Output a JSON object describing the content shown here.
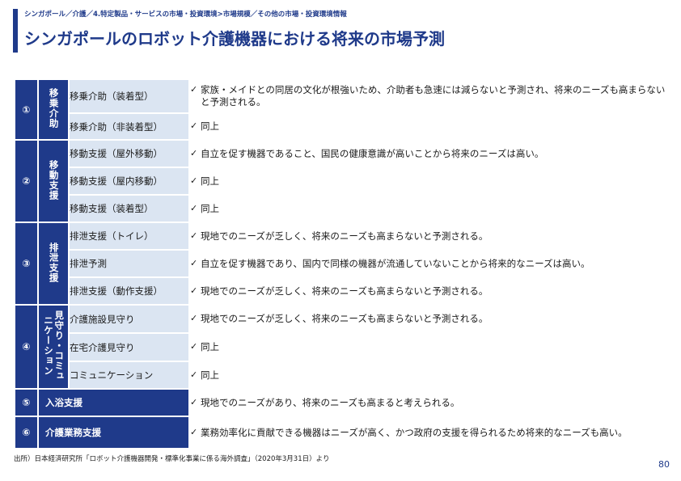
{
  "header": {
    "breadcrumb": "シンガポール／介護／4.特定製品・サービスの市場・投資環境>市場規模／その他の市場・投資環境情報",
    "title": "シンガポールのロボット介護機器における将来の市場予測"
  },
  "table": {
    "groups": [
      {
        "number": "①",
        "category": "移乗介助",
        "rows": [
          {
            "item": "移乗介助（装着型）",
            "desc": "家族・メイドとの同居の文化が根強いため、介助者も急速には減らないと予測され、将来のニーズも高まらないと予測される。"
          },
          {
            "item": "移乗介助（非装着型）",
            "desc": "同上"
          }
        ]
      },
      {
        "number": "②",
        "category": "移動支援",
        "rows": [
          {
            "item": "移動支援（屋外移動）",
            "desc": "自立を促す機器であること、国民の健康意識が高いことから将来のニーズは高い。"
          },
          {
            "item": "移動支援（屋内移動）",
            "desc": "同上"
          },
          {
            "item": "移動支援（装着型）",
            "desc": "同上"
          }
        ]
      },
      {
        "number": "③",
        "category": "排泄支援",
        "rows": [
          {
            "item": "排泄支援（トイレ）",
            "desc": "現地でのニーズが乏しく、将来のニーズも高まらないと予測される。"
          },
          {
            "item": "排泄予測",
            "desc": "自立を促す機器であり、国内で同様の機器が流通していないことから将来的なニーズは高い。"
          },
          {
            "item": "排泄支援（動作支援）",
            "desc": "現地でのニーズが乏しく、将来のニーズも高まらないと予測される。"
          }
        ]
      },
      {
        "number": "④",
        "category": "見守り・コミュニケーション",
        "rows": [
          {
            "item": "介護施設見守り",
            "desc": "現地でのニーズが乏しく、将来のニーズも高まらないと予測される。"
          },
          {
            "item": "在宅介護見守り",
            "desc": "同上"
          },
          {
            "item": "コミュニケーション",
            "desc": "同上"
          }
        ]
      },
      {
        "number": "⑤",
        "category": "入浴支援",
        "rows": [
          {
            "item": "",
            "desc": "現地でのニーズがあり、将来のニーズも高まると考えられる。"
          }
        ]
      },
      {
        "number": "⑥",
        "category": "介護業務支援",
        "rows": [
          {
            "item": "",
            "desc": "業務効率化に貢献できる機器はニーズが高く、かつ政府の支援を得られるため将来的なニーズも高い。"
          }
        ]
      }
    ]
  },
  "footer": {
    "source": "出所）日本経済研究所「ロボット介護機器開発・標準化事業に係る海外調査」（2020年3月31日）より",
    "page_number": "80"
  },
  "icons": {
    "check": "checkmark-icon"
  }
}
